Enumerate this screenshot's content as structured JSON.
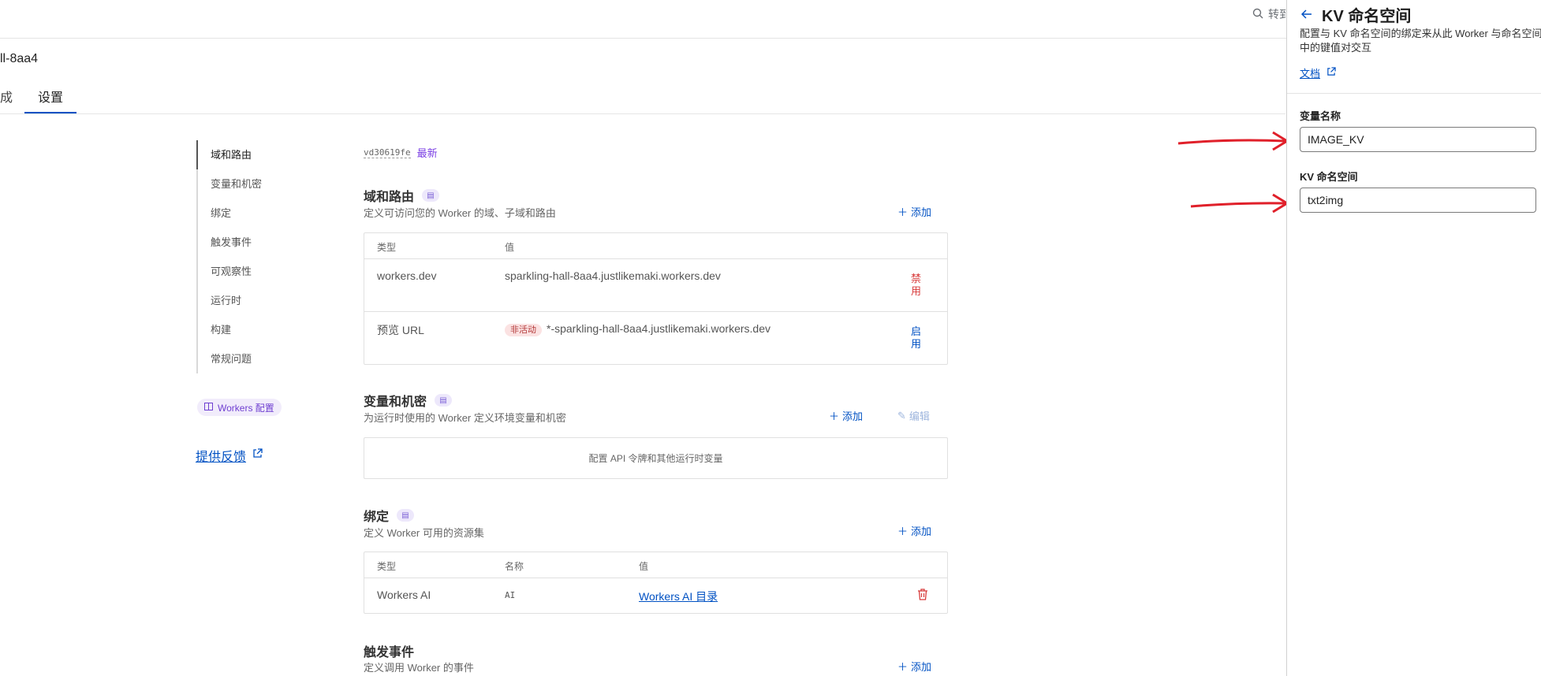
{
  "header": {
    "search_label": "转到..."
  },
  "worker": {
    "name_fragment": "ll-8aa4"
  },
  "tabs": [
    {
      "label": "成"
    },
    {
      "label": "设置"
    }
  ],
  "sidenav": {
    "items": [
      {
        "label": "域和路由"
      },
      {
        "label": "变量和机密"
      },
      {
        "label": "绑定"
      },
      {
        "label": "触发事件"
      },
      {
        "label": "可观察性"
      },
      {
        "label": "运行时"
      },
      {
        "label": "构建"
      },
      {
        "label": "常规问题"
      }
    ],
    "config_pill": "Workers 配置",
    "feedback": "提供反馈"
  },
  "version": {
    "hash": "vd30619fe",
    "tag": "最新"
  },
  "domains": {
    "title": "域和路由",
    "desc": "定义可访问您的 Worker 的域、子域和路由",
    "add": "添加",
    "col_type": "类型",
    "col_value": "值",
    "rows": [
      {
        "type": "workers.dev",
        "badge": "",
        "value": "sparkling-hall-8aa4.justlikemaki.workers.dev",
        "action": "禁用"
      },
      {
        "type": "预览 URL",
        "badge": "非活动",
        "value": "*-sparkling-hall-8aa4.justlikemaki.workers.dev",
        "action": "启用"
      }
    ]
  },
  "variables": {
    "title": "变量和机密",
    "desc": "为运行时使用的 Worker 定义环境变量和机密",
    "add": "添加",
    "edit": "编辑",
    "empty": "配置 API 令牌和其他运行时变量"
  },
  "bindings": {
    "title": "绑定",
    "desc": "定义 Worker 可用的资源集",
    "add": "添加",
    "col_type": "类型",
    "col_name": "名称",
    "col_value": "值",
    "rows": [
      {
        "type": "Workers AI",
        "name": "AI",
        "value": "Workers AI 目录"
      }
    ]
  },
  "triggers": {
    "title": "触发事件",
    "desc": "定义调用 Worker 的事件",
    "add": "添加"
  },
  "panel": {
    "title": "KV 命名空间",
    "desc": "配置与 KV 命名空间的绑定来从此 Worker 与命名空间中的键值对交互",
    "doc": "文档",
    "var_label": "变量名称",
    "var_value": "IMAGE_KV",
    "ns_label": "KV 命名空间",
    "ns_value": "txt2img"
  },
  "colors": {
    "accent": "#0051c3",
    "annotation": "#e0202a",
    "danger": "#d83b3b",
    "purple": "#7b3fe4"
  },
  "icons": [
    "search-icon",
    "back-arrow-icon",
    "external-link-icon",
    "doc-icon",
    "plus-icon",
    "pencil-icon",
    "trash-icon",
    "arrow-annotation-icon"
  ]
}
